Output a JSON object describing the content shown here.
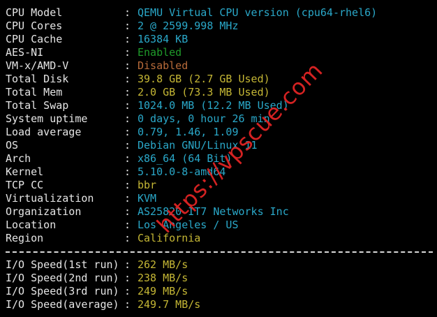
{
  "colors": {
    "background": "#000000",
    "key": "#e6e6e6",
    "cyan": "#2aa8c9",
    "yellow": "#c5b735",
    "green": "#1f9b2a",
    "brown": "#b86b3a",
    "watermark": "#e02424"
  },
  "system": [
    {
      "key": "CPU Model",
      "value": "QEMU Virtual CPU version (cpu64-rhel6)",
      "color": "#2aa8c9"
    },
    {
      "key": "CPU Cores",
      "value": "2 @ 2599.998 MHz",
      "color": "#2aa8c9"
    },
    {
      "key": "CPU Cache",
      "value": "16384 KB",
      "color": "#2aa8c9"
    },
    {
      "key": "AES-NI",
      "value": "Enabled",
      "color": "#1f9b2a"
    },
    {
      "key": "VM-x/AMD-V",
      "value": "Disabled",
      "color": "#b86b3a"
    },
    {
      "key": "Total Disk",
      "value": "39.8 GB (2.7 GB Used)",
      "color": "#c5b735"
    },
    {
      "key": "Total Mem",
      "value": "2.0 GB (73.3 MB Used)",
      "color": "#c5b735"
    },
    {
      "key": "Total Swap",
      "value": "1024.0 MB (12.2 MB Used)",
      "color": "#2aa8c9"
    },
    {
      "key": "System uptime",
      "value": "0 days, 0 hour 26 min",
      "color": "#2aa8c9"
    },
    {
      "key": "Load average",
      "value": "0.79, 1.46, 1.09",
      "color": "#2aa8c9"
    },
    {
      "key": "OS",
      "value": "Debian GNU/Linux 11",
      "color": "#2aa8c9"
    },
    {
      "key": "Arch",
      "value": "x86_64 (64 Bit)",
      "color": "#2aa8c9"
    },
    {
      "key": "Kernel",
      "value": "5.10.0-8-amd64",
      "color": "#2aa8c9"
    },
    {
      "key": "TCP CC",
      "value": "bbr",
      "color": "#c5b735"
    },
    {
      "key": "Virtualization",
      "value": "KVM",
      "color": "#2aa8c9"
    },
    {
      "key": "Organization",
      "value": "AS25820 IT7 Networks Inc",
      "color": "#2aa8c9"
    },
    {
      "key": "Location",
      "value": "Los Angeles / US",
      "color": "#2aa8c9"
    },
    {
      "key": "Region",
      "value": "California",
      "color": "#c5b735"
    }
  ],
  "io": [
    {
      "key": "I/O Speed(1st run)",
      "value": "262 MB/s",
      "color": "#c5b735"
    },
    {
      "key": "I/O Speed(2nd run)",
      "value": "238 MB/s",
      "color": "#c5b735"
    },
    {
      "key": "I/O Speed(3rd run)",
      "value": "249 MB/s",
      "color": "#c5b735"
    },
    {
      "key": "I/O Speed(average)",
      "value": "249.7 MB/s",
      "color": "#c5b735"
    }
  ],
  "separator": ":",
  "watermark": "https://vpscue.com"
}
